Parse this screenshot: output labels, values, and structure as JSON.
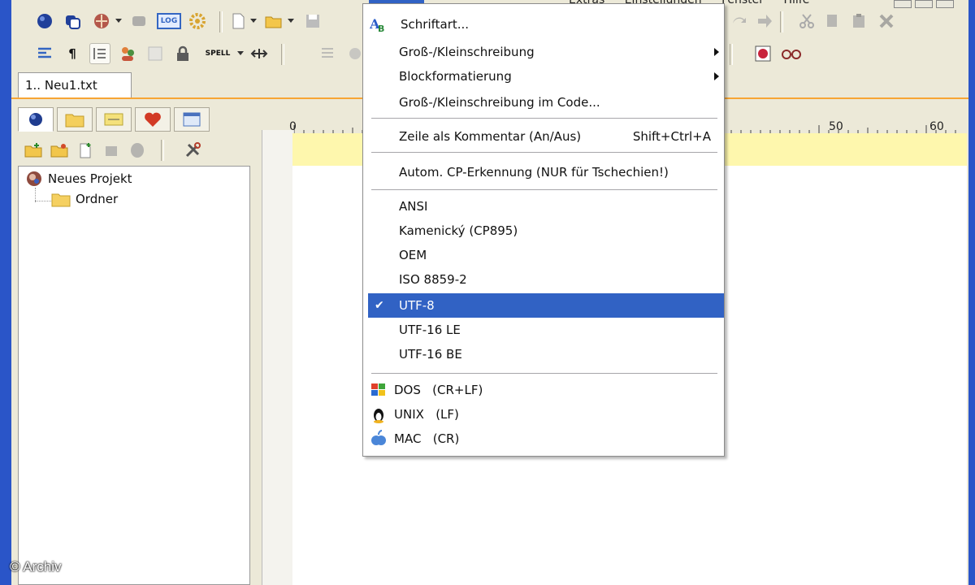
{
  "menubar": {
    "items": [
      "Extras",
      "Einstellungen",
      "Fenster",
      "Hilfe"
    ]
  },
  "toolbar1": {
    "log_label": "LOG"
  },
  "toolbar2": {
    "pilcrow": "¶",
    "spell_label": "SPELL"
  },
  "tabs": {
    "doc": "1.. Neu1.txt"
  },
  "project": {
    "root": "Neues Projekt",
    "folder": "Ordner"
  },
  "ruler": {
    "marks": [
      "0",
      "50",
      "60"
    ]
  },
  "menu": {
    "items": [
      {
        "label": "Schriftart..."
      },
      {
        "label": "Groß-/Kleinschreibung"
      },
      {
        "label": "Blockformatierung"
      },
      {
        "label": "Groß-/Kleinschreibung im Code..."
      },
      {
        "label": "Zeile als Kommentar (An/Aus)",
        "shortcut": "Shift+Ctrl+A"
      },
      {
        "label": "Autom. CP-Erkennung (NUR für Tschechien!)"
      },
      {
        "label": "ANSI"
      },
      {
        "label": "Kamenický (CP895)"
      },
      {
        "label": "OEM"
      },
      {
        "label": "ISO 8859-2"
      },
      {
        "label": "UTF-8",
        "checkmark": "✔"
      },
      {
        "label": "UTF-16 LE"
      },
      {
        "label": "UTF-16 BE"
      },
      {
        "label": "DOS   (CR+LF)"
      },
      {
        "label": "UNIX   (LF)"
      },
      {
        "label": "MAC   (CR)"
      }
    ]
  },
  "copyright": "© Archiv",
  "colors": {
    "selection": "#3162c4",
    "accent_tab": "#f7a534",
    "ruler_highlight": "#fef7ad"
  }
}
